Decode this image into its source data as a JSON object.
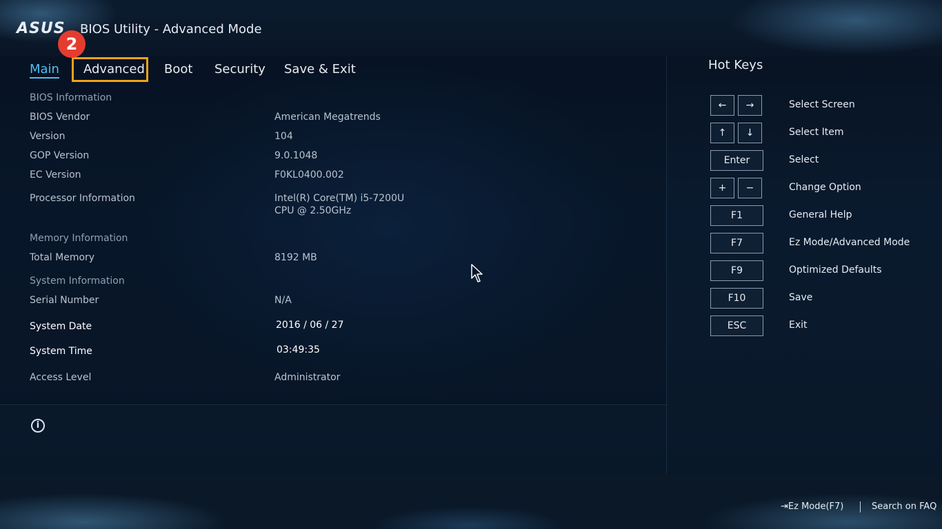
{
  "header": {
    "logo": "ASUS",
    "title": "BIOS Utility - Advanced Mode",
    "step_badge": "2"
  },
  "tabs": [
    {
      "label": "Main",
      "active": true
    },
    {
      "label": "Advanced",
      "active": false,
      "highlighted": true
    },
    {
      "label": "Boot",
      "active": false
    },
    {
      "label": "Security",
      "active": false
    },
    {
      "label": "Save & Exit",
      "active": false
    }
  ],
  "main": {
    "bios_info_heading": "BIOS Information",
    "rows": [
      {
        "label": "BIOS Vendor",
        "value": "American Megatrends"
      },
      {
        "label": "Version",
        "value": "104"
      },
      {
        "label": "GOP Version",
        "value": "9.0.1048"
      },
      {
        "label": "EC Version",
        "value": "F0KL0400.002"
      },
      {
        "label": "Processor Information",
        "value_line1": "Intel(R) Core(TM) i5-7200U",
        "value_line2": "CPU @ 2.50GHz"
      }
    ],
    "memory_heading": "Memory Information",
    "total_memory": {
      "label": "Total Memory",
      "value": "8192 MB"
    },
    "system_heading": "System Information",
    "serial": {
      "label": "Serial Number",
      "value": "N/A"
    },
    "date": {
      "label": "System Date",
      "value": "2016 / 06 / 27"
    },
    "time": {
      "label": "System Time",
      "value": "03:49:35"
    },
    "access": {
      "label": "Access Level",
      "value": "Administrator"
    },
    "info_icon": "i"
  },
  "hotkeys": {
    "title": "Hot Keys",
    "items": [
      {
        "keys": [
          "←",
          "→"
        ],
        "desc": "Select Screen"
      },
      {
        "keys": [
          "↑",
          "↓"
        ],
        "desc": "Select Item"
      },
      {
        "keys": [
          "Enter"
        ],
        "desc": "Select"
      },
      {
        "keys": [
          "+",
          "−"
        ],
        "desc": "Change Option"
      },
      {
        "keys": [
          "F1"
        ],
        "desc": "General Help"
      },
      {
        "keys": [
          "F7"
        ],
        "desc": "Ez Mode/Advanced Mode"
      },
      {
        "keys": [
          "F9"
        ],
        "desc": "Optimized Defaults"
      },
      {
        "keys": [
          "F10"
        ],
        "desc": "Save"
      },
      {
        "keys": [
          "ESC"
        ],
        "desc": "Exit"
      }
    ]
  },
  "footer": {
    "ez_mode": "⇥Ez Mode(F7)",
    "search_faq": "Search on FAQ"
  },
  "colors": {
    "accent": "#4ec0f0",
    "highlight": "#f2a21b",
    "badge": "#e43d30"
  },
  "icons": {
    "info": "info-icon",
    "cursor": "mouse-pointer-icon",
    "ez_mode": "exit-arrow-icon"
  }
}
